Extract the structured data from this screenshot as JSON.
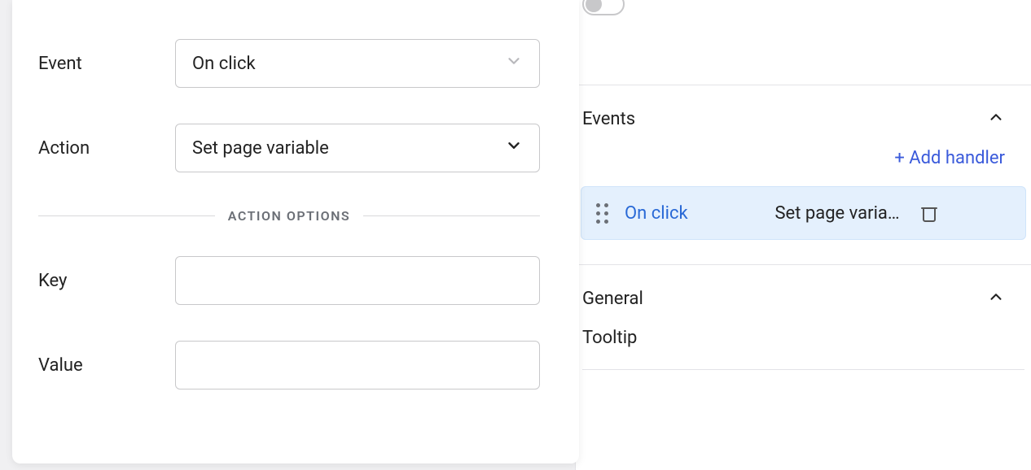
{
  "form": {
    "event_label": "Event",
    "event_value": "On click",
    "action_label": "Action",
    "action_value": "Set page variable",
    "options_divider": "ACTION OPTIONS",
    "key_label": "Key",
    "key_value": "",
    "value_label": "Value",
    "value_value": ""
  },
  "sidebar": {
    "events_section": {
      "title": "Events",
      "add_handler": "+ Add handler",
      "items": [
        {
          "event": "On click",
          "action": "Set page varia…"
        }
      ]
    },
    "general_section": {
      "title": "General",
      "tooltip_label": "Tooltip"
    }
  }
}
